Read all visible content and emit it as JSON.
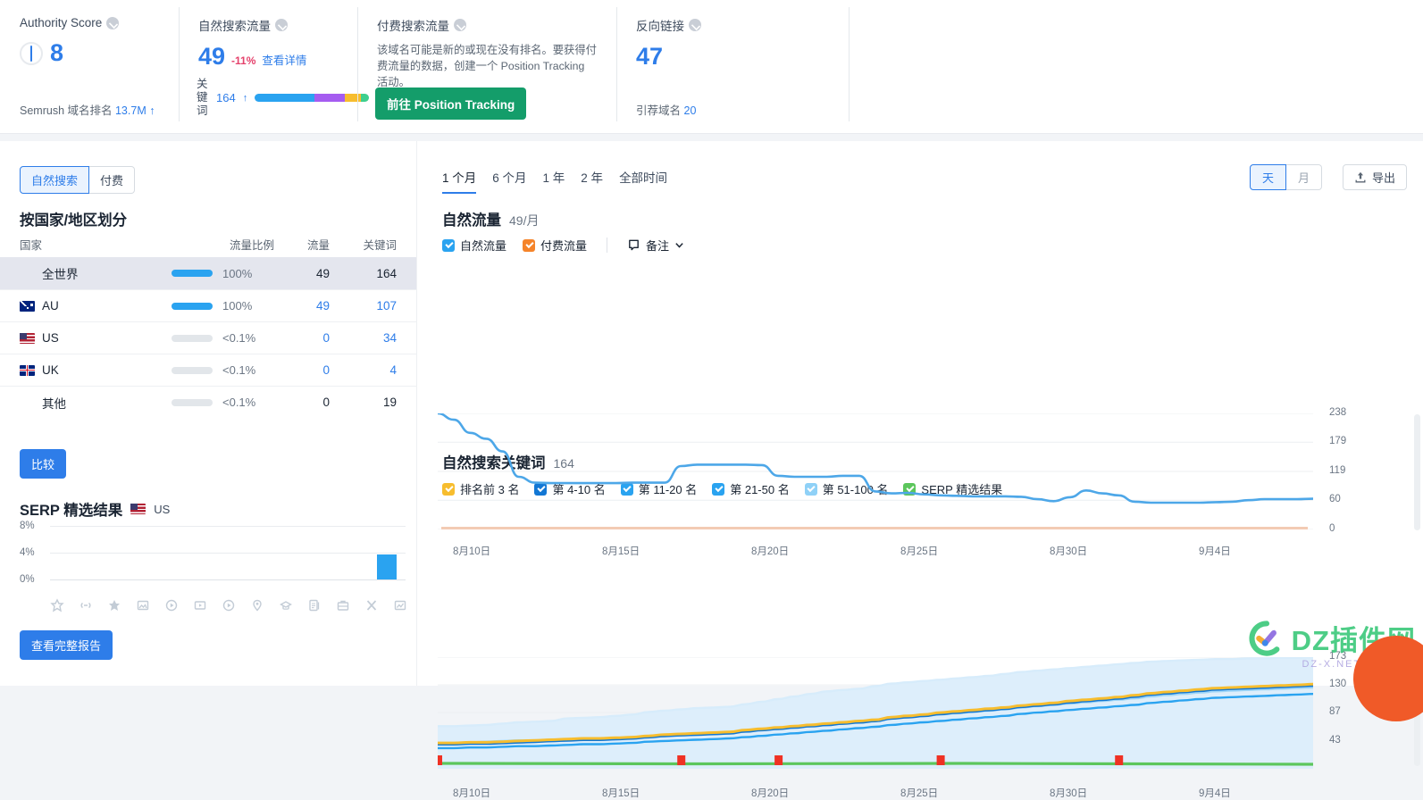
{
  "top_metrics": {
    "authority": {
      "title": "Authority Score",
      "value": "8",
      "footer_label": "Semrush 域名排名",
      "footer_value": "13.7M",
      "footer_arrow": "↑"
    },
    "organic": {
      "title": "自然搜索流量",
      "value": "49",
      "delta": "-11%",
      "details_link": "查看详情",
      "keywords_label": "关键词",
      "keywords_value": "164",
      "keywords_arrow": "↑",
      "bar_segments": [
        {
          "color": "#2aa3f0",
          "width": 52
        },
        {
          "color": "#a55cf0",
          "width": 27
        },
        {
          "color": "#f7bd2e",
          "width": 14
        },
        {
          "color": "#3ecf8e",
          "width": 7
        }
      ]
    },
    "paid": {
      "title": "付费搜索流量",
      "description": "该域名可能是新的或现在没有排名。要获得付费流量的数据，创建一个 Position Tracking 活动。",
      "cta": "前往 Position Tracking"
    },
    "backlinks": {
      "title": "反向链接",
      "value": "47",
      "footer_label": "引荐域名",
      "footer_value": "20"
    }
  },
  "left": {
    "segmented": {
      "options": [
        "自然搜索",
        "付费"
      ],
      "active": 0
    },
    "country_title": "按国家/地区划分",
    "table": {
      "headers": [
        "国家",
        "流量比例",
        "流量",
        "关键词"
      ],
      "rows": [
        {
          "country": "全世界",
          "flag": null,
          "share_pct": 100,
          "share_text": "100%",
          "traffic": "49",
          "keywords": "164",
          "highlight": true
        },
        {
          "country": "AU",
          "flag": "au",
          "share_pct": 100,
          "share_text": "100%",
          "traffic": "49",
          "keywords": "107",
          "highlight": false
        },
        {
          "country": "US",
          "flag": "us",
          "share_pct": 0,
          "share_text": "<0.1%",
          "traffic": "0",
          "keywords": "34",
          "highlight": false
        },
        {
          "country": "UK",
          "flag": "uk",
          "share_pct": 0,
          "share_text": "<0.1%",
          "traffic": "0",
          "keywords": "4",
          "highlight": false
        },
        {
          "country": "其他",
          "flag": null,
          "share_pct": 0,
          "share_text": "<0.1%",
          "traffic": "0",
          "keywords": "19",
          "highlight": false
        }
      ]
    },
    "compare_button": "比较",
    "serp": {
      "title": "SERP 精选结果",
      "country": "US",
      "y_ticks": [
        "8%",
        "4%",
        "0%"
      ],
      "icons": [
        "featured-snippet-icon",
        "sitelink-icon",
        "reviews-icon",
        "image-pack-icon",
        "video-icon",
        "video-carousel-icon",
        "featured-video-icon",
        "local-pack-icon",
        "knowledge-panel-icon",
        "faq-icon",
        "jobs-icon",
        "twitter-x-icon",
        "instant-answer-icon"
      ],
      "bar_values": [
        0,
        0,
        0,
        0,
        0,
        0,
        0,
        0,
        0,
        0,
        0,
        0,
        2.6
      ],
      "report_button": "查看完整报告"
    }
  },
  "right": {
    "period_tabs": [
      "1 个月",
      "6 个月",
      "1 年",
      "2 年",
      "全部时间"
    ],
    "period_active": 0,
    "day_month": {
      "options": [
        "天",
        "月"
      ],
      "active": 0
    },
    "export_button": "导出",
    "chart1": {
      "title": "自然流量",
      "subtitle": "49/月",
      "legend": [
        {
          "label": "自然流量",
          "color": "#2aa3f0"
        },
        {
          "label": "付费流量",
          "color": "#f5842a"
        }
      ],
      "notes_label": "备注"
    },
    "chart2": {
      "title": "自然搜索关键词",
      "subtitle": "164",
      "legend": [
        {
          "label": "排名前 3 名",
          "color": "#f7bd2e"
        },
        {
          "label": "第 4-10 名",
          "color": "#1277d4"
        },
        {
          "label": "第 11-20 名",
          "color": "#2aa3f0"
        },
        {
          "label": "第 21-50 名",
          "color": "#2aa3f0"
        },
        {
          "label": "第 51-100 名",
          "color": "#8fd1f7"
        },
        {
          "label": "SERP 精选结果",
          "color": "#5cc65c"
        }
      ]
    }
  },
  "watermark": {
    "text": "DZ插件网",
    "sub": "DZ-X.NET"
  },
  "chart_data": [
    {
      "type": "line",
      "title": "自然流量",
      "subtitle": "49/月",
      "ylabel": "",
      "xlabel": "",
      "ylim": [
        0,
        238
      ],
      "y_ticks": [
        238,
        179,
        119,
        60,
        0
      ],
      "x_ticks": [
        "8月10日",
        "8月15日",
        "8月20日",
        "8月25日",
        "8月30日",
        "9月4日"
      ],
      "grid": true,
      "legend_position": "top",
      "series": [
        {
          "name": "自然流量",
          "color": "#4da7e8",
          "values": [
            238,
            225,
            198,
            186,
            160,
            108,
            96,
            95,
            95,
            95,
            95,
            95,
            96,
            96,
            96,
            130,
            133,
            133,
            133,
            133,
            132,
            110,
            108,
            108,
            108,
            110,
            110,
            78,
            74,
            75,
            72,
            70,
            69,
            68,
            68,
            68,
            67,
            62,
            58,
            66,
            80,
            74,
            70,
            57,
            55,
            55,
            55,
            55,
            56,
            57,
            60,
            62,
            62,
            62,
            63
          ]
        },
        {
          "name": "付费流量",
          "color": "#f3cbb4",
          "values": [
            0,
            0,
            0,
            0,
            0,
            0,
            0,
            0,
            0,
            0,
            0,
            0,
            0,
            0,
            0,
            0,
            0,
            0,
            0,
            0,
            0,
            0,
            0,
            0,
            0,
            0,
            0,
            0,
            0,
            0,
            0,
            0,
            0,
            0,
            0,
            0,
            0,
            0,
            0,
            0,
            0,
            0,
            0,
            0,
            0,
            0,
            0,
            0,
            0,
            0,
            0,
            0,
            0,
            0,
            0
          ]
        }
      ]
    },
    {
      "type": "area",
      "title": "自然搜索关键词",
      "subtitle": "164",
      "ylim": [
        0,
        173
      ],
      "y_ticks": [
        173,
        130,
        87,
        43
      ],
      "x_ticks": [
        "8月10日",
        "8月15日",
        "8月20日",
        "8月25日",
        "8月30日",
        "9月4日"
      ],
      "grid": true,
      "legend_position": "top",
      "series": [
        {
          "name": "第 51-100 名",
          "color": "#d7ecfb",
          "values": [
            66,
            66,
            67,
            68,
            70,
            72,
            73,
            74,
            78,
            79,
            80,
            82,
            84,
            88,
            90,
            92,
            94,
            95,
            96,
            100,
            104,
            108,
            112,
            116,
            120,
            122,
            124,
            128,
            132,
            134,
            136,
            138,
            140,
            142,
            144,
            147,
            150,
            152,
            154,
            156,
            158,
            160,
            162,
            164,
            166,
            167,
            168,
            169,
            170,
            170,
            171,
            171,
            172,
            172,
            173
          ]
        },
        {
          "name": "第 21-50 名",
          "color": "#9fd6f7",
          "values": [
            40,
            40,
            41,
            42,
            43,
            44,
            44,
            45,
            46,
            47,
            47,
            48,
            49,
            51,
            52,
            53,
            54,
            55,
            56,
            58,
            60,
            62,
            64,
            66,
            68,
            70,
            72,
            74,
            78,
            80,
            82,
            84,
            86,
            88,
            90,
            92,
            95,
            97,
            99,
            101,
            103,
            105,
            107,
            109,
            112,
            114,
            116,
            118,
            120,
            121,
            122,
            123,
            124,
            125,
            126
          ]
        },
        {
          "name": "第 11-20 名",
          "color": "#2aa3f0",
          "values": [
            32,
            32,
            33,
            33,
            34,
            35,
            35,
            36,
            37,
            38,
            38,
            39,
            40,
            42,
            43,
            44,
            45,
            46,
            47,
            49,
            51,
            53,
            55,
            57,
            59,
            61,
            63,
            65,
            68,
            70,
            72,
            74,
            76,
            78,
            80,
            82,
            85,
            87,
            89,
            91,
            93,
            95,
            97,
            99,
            102,
            104,
            106,
            108,
            110,
            111,
            112,
            113,
            114,
            115,
            116
          ]
        },
        {
          "name": "第 4-10 名",
          "color": "#1277d4",
          "values": [
            38,
            38,
            39,
            39,
            40,
            41,
            42,
            43,
            44,
            45,
            45,
            46,
            47,
            49,
            51,
            52,
            53,
            54,
            55,
            58,
            60,
            62,
            64,
            66,
            68,
            70,
            72,
            74,
            78,
            80,
            82,
            85,
            87,
            89,
            91,
            93,
            96,
            98,
            100,
            103,
            105,
            107,
            109,
            112,
            115,
            117,
            119,
            121,
            123,
            124,
            125,
            126,
            127,
            128,
            129
          ]
        },
        {
          "name": "排名前 3 名",
          "color": "#f7bd2e",
          "values": [
            40,
            40,
            41,
            41,
            42,
            43,
            44,
            45,
            46,
            47,
            47,
            48,
            49,
            51,
            53,
            54,
            55,
            56,
            57,
            60,
            62,
            64,
            66,
            68,
            70,
            72,
            74,
            76,
            80,
            82,
            84,
            87,
            89,
            91,
            93,
            95,
            98,
            100,
            102,
            105,
            107,
            109,
            111,
            114,
            117,
            119,
            121,
            123,
            125,
            126,
            127,
            128,
            129,
            130,
            131
          ]
        },
        {
          "name": "SERP 精选结果",
          "color": "#5cc65c",
          "values": [
            1,
            1,
            1,
            1,
            1,
            1,
            1,
            1,
            1,
            1,
            1,
            1,
            1,
            1,
            1,
            1,
            1,
            1,
            1,
            1,
            1,
            1,
            1,
            1,
            1,
            1,
            1,
            1,
            1,
            1,
            1,
            1,
            1,
            1,
            1,
            1,
            1,
            1,
            1,
            1,
            1,
            1,
            1,
            1,
            1,
            1,
            1,
            1,
            1,
            1,
            1,
            1,
            1,
            1,
            1
          ]
        }
      ],
      "markers": [
        {
          "x": 0
        },
        {
          "x": 15
        },
        {
          "x": 21
        },
        {
          "x": 31
        },
        {
          "x": 42
        }
      ]
    }
  ]
}
